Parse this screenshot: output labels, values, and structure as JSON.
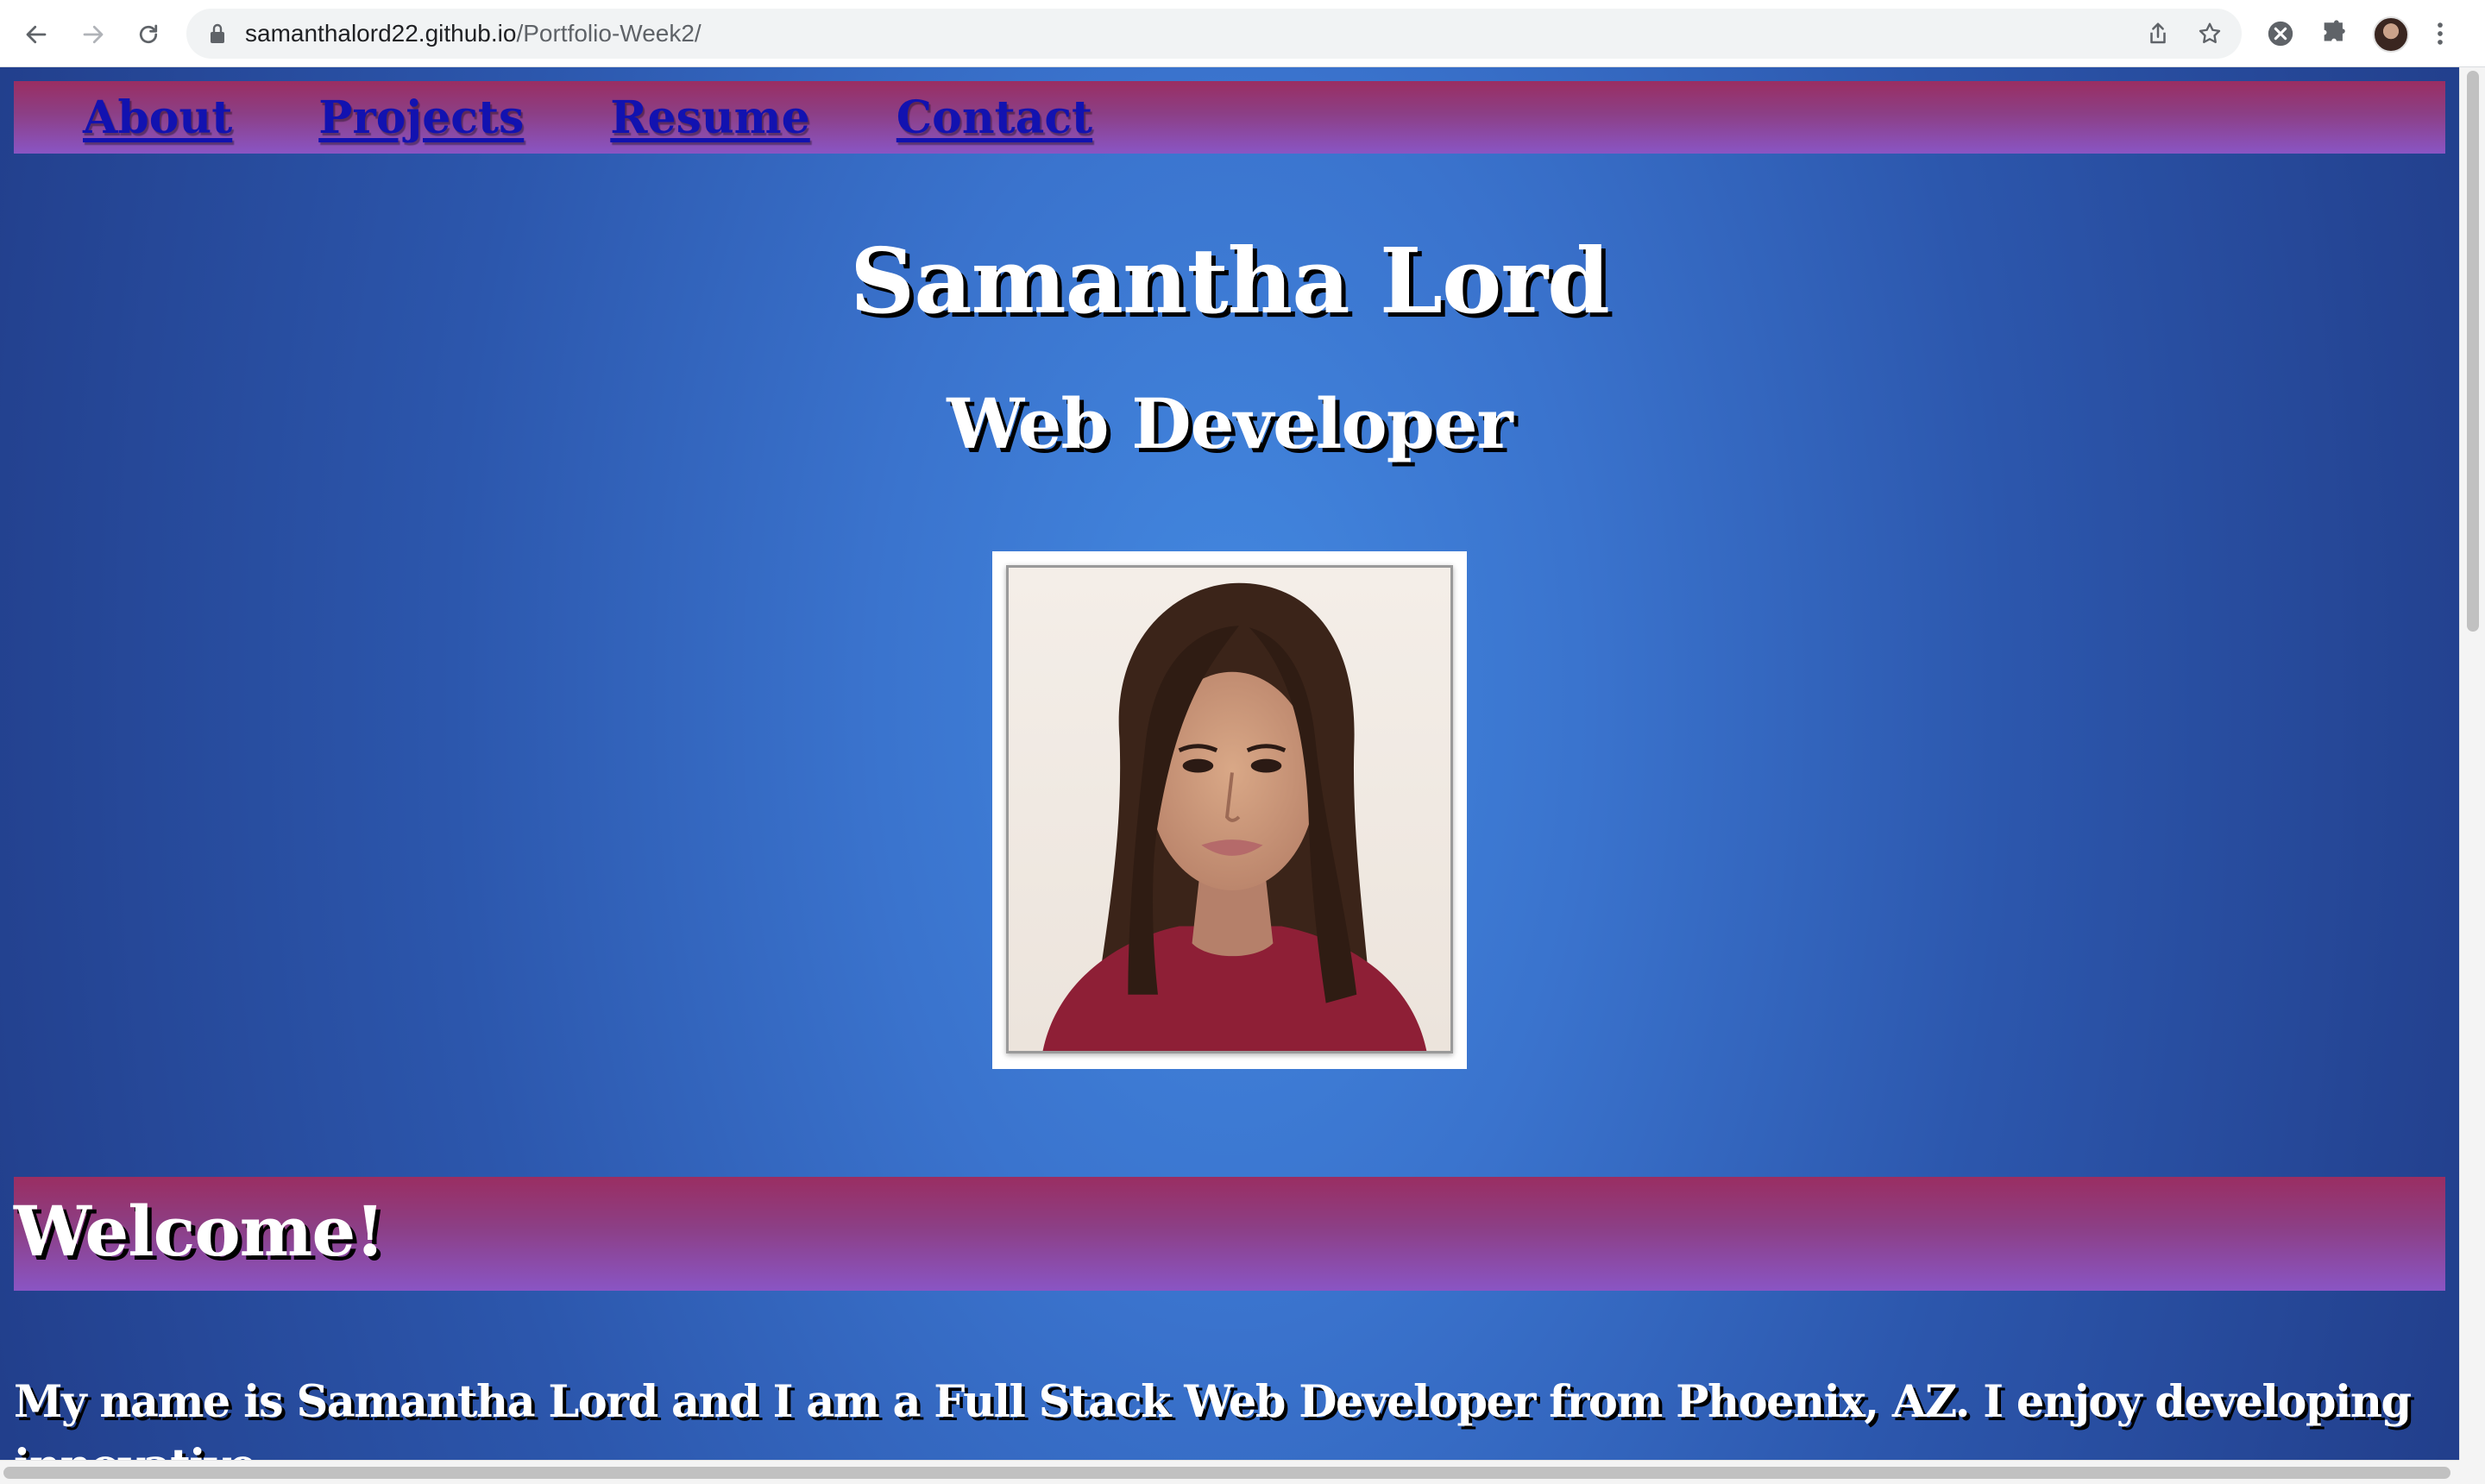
{
  "browser": {
    "url_host": "samanthalord22.github.io",
    "url_path": "/Portfolio-Week2/",
    "icons": {
      "back": "arrow-left-icon",
      "forward": "arrow-right-icon",
      "reload": "reload-icon",
      "lock": "lock-icon",
      "share": "share-icon",
      "bookmark": "star-icon",
      "extension_x": "extension-x-icon",
      "extensions": "puzzle-icon",
      "profile": "profile-avatar",
      "menu": "kebab-menu-icon"
    }
  },
  "nav": {
    "links": [
      {
        "label": "About"
      },
      {
        "label": "Projects"
      },
      {
        "label": "Resume"
      },
      {
        "label": "Contact"
      }
    ]
  },
  "hero": {
    "name": "Samantha Lord",
    "role": "Web Developer"
  },
  "welcome": {
    "heading": "Welcome!",
    "intro": "My name is Samantha Lord and I am a Full Stack Web Developer from Phoenix, AZ. I enjoy developing innovative"
  },
  "colors": {
    "page_gradient_center": "#4388e0",
    "page_gradient_edge": "#223f8c",
    "bar_top": "#9a2e62",
    "bar_bottom": "#8a55c4",
    "nav_link": "#1212b0",
    "heading_text": "#ffffff"
  }
}
